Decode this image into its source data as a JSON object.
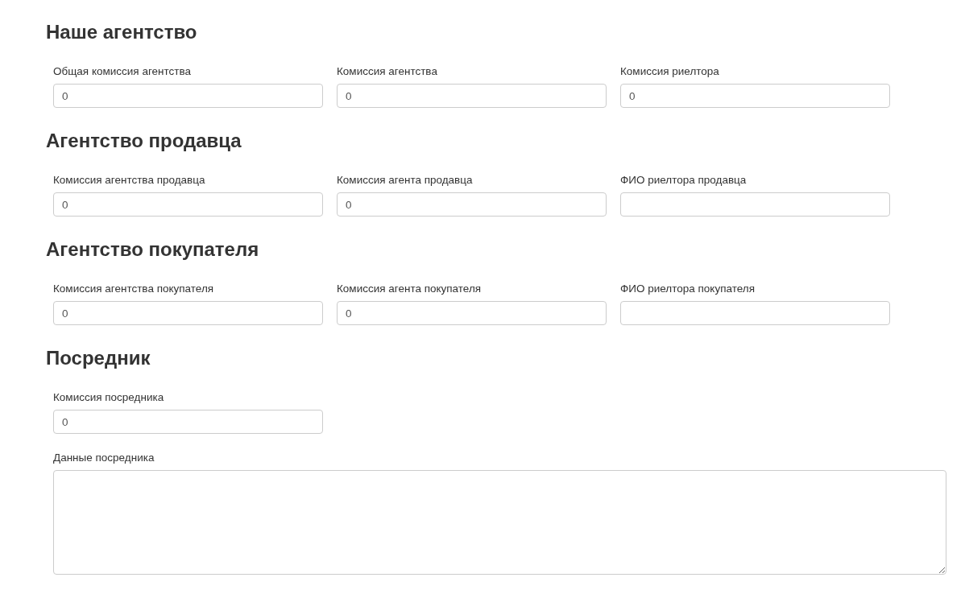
{
  "sections": [
    {
      "title": "Наше агентство",
      "fields": [
        {
          "kind": "input",
          "label": "Общая комиссия агентства",
          "value": "0"
        },
        {
          "kind": "input",
          "label": "Комиссия агентства",
          "value": "0"
        },
        {
          "kind": "input",
          "label": "Комиссия риелтора",
          "value": "0"
        }
      ]
    },
    {
      "title": "Агентство продавца",
      "fields": [
        {
          "kind": "input",
          "label": "Комиссия агентства продавца",
          "value": "0"
        },
        {
          "kind": "input",
          "label": "Комиссия агента продавца",
          "value": "0"
        },
        {
          "kind": "input",
          "label": "ФИО риелтора продавца"
        }
      ]
    },
    {
      "title": "Агентство покупателя",
      "fields": [
        {
          "kind": "input",
          "label": "Комиссия агентства покупателя",
          "value": "0"
        },
        {
          "kind": "input",
          "label": "Комиссия агента покупателя",
          "value": "0"
        },
        {
          "kind": "input",
          "label": "ФИО риелтора покупателя"
        }
      ]
    },
    {
      "title": "Посредник",
      "fields": [
        {
          "kind": "input",
          "label": "Комиссия посредника",
          "value": "0"
        },
        {
          "kind": "textarea",
          "label": "Данные посредника"
        }
      ]
    }
  ]
}
